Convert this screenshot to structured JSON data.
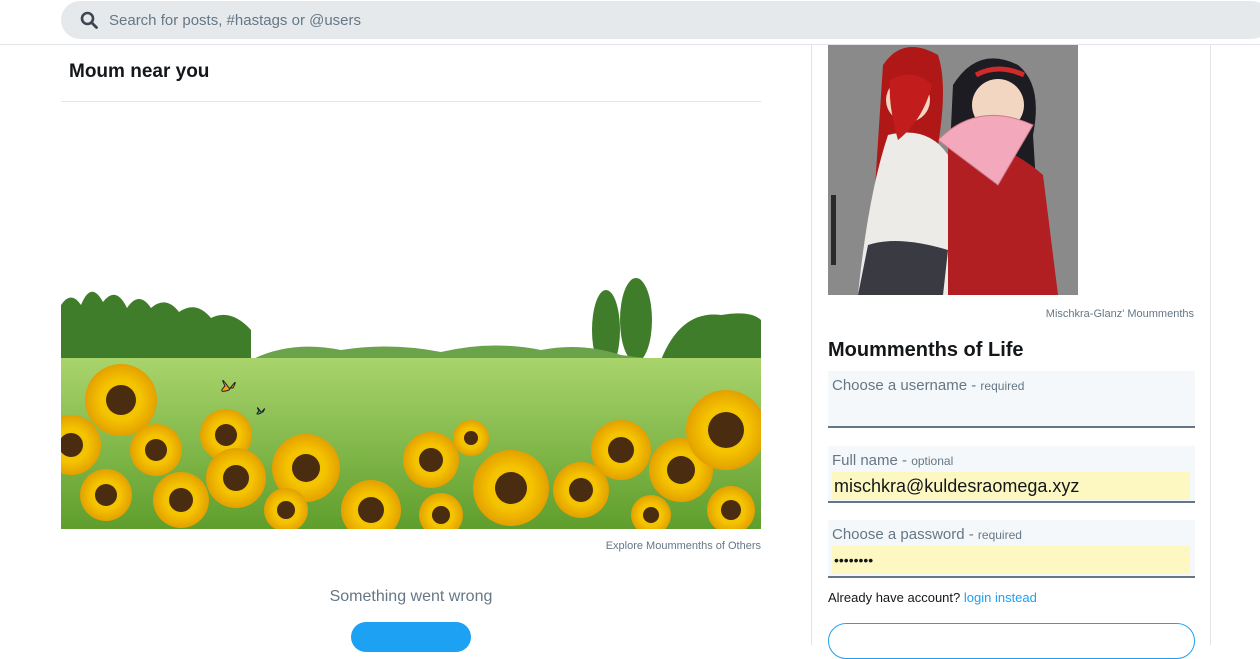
{
  "search": {
    "placeholder": "Search for posts, #hastags or @users",
    "value": ""
  },
  "main": {
    "title": "Moum near you",
    "banner_caption": "Explore Moummenths of Others",
    "error_text": "Something went wrong"
  },
  "sidebar": {
    "image_caption": "Mischkra-Glanz' Moummenths",
    "title": "Moummenths of Life",
    "fields": [
      {
        "label": "Choose a username - ",
        "note": "required",
        "value": ""
      },
      {
        "label": "Full name - ",
        "note": "optional",
        "value": "mischkra@kuldesraomega.xyz"
      },
      {
        "label": "Choose a password - ",
        "note": "required",
        "value": "••••••••"
      }
    ],
    "already_text": "Already have account? ",
    "login_link": "login instead"
  },
  "colors": {
    "accent": "#1da1f2",
    "muted_text": "#657786",
    "search_bg": "#e6e9ec",
    "autofill_bg": "#fdf8c2"
  },
  "icons": {
    "search": "search-icon"
  }
}
